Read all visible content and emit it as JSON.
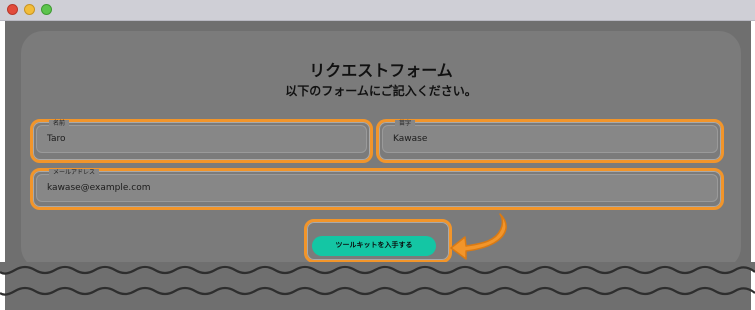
{
  "window": {
    "controls": [
      "close",
      "minimize",
      "maximize"
    ]
  },
  "form": {
    "title": "リクエストフォーム",
    "subtitle": "以下のフォームにご記入ください。",
    "first_name_label": "名前",
    "first_name_value": "Taro",
    "last_name_label": "苗字",
    "last_name_value": "Kawase",
    "email_label": "メールアドレス",
    "email_value": "kawase@example.com",
    "submit_label": "ツールキットを入手する"
  },
  "colors": {
    "highlight": "#f2952a",
    "button": "#14c6a4",
    "overlay": "#6f6f6f"
  }
}
